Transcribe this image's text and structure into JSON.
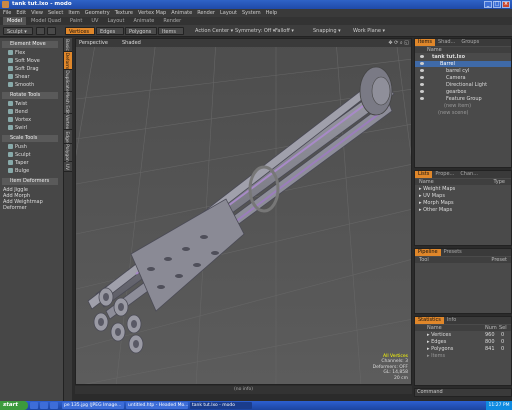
{
  "window": {
    "title": "tank tut.lxo - modo"
  },
  "menu": [
    "File",
    "Edit",
    "View",
    "Select",
    "Item",
    "Geometry",
    "Texture",
    "Vertex Map",
    "Animate",
    "Render",
    "Layout",
    "System",
    "Help"
  ],
  "layout_tabs": [
    {
      "label": "Model",
      "active": true
    },
    {
      "label": "Model Quad",
      "active": false
    },
    {
      "label": "Paint",
      "active": false
    },
    {
      "label": "UV",
      "active": false
    },
    {
      "label": "Layout",
      "active": false
    },
    {
      "label": "Animate",
      "active": false
    },
    {
      "label": "Render",
      "active": false
    }
  ],
  "toolbar": {
    "sculpt": "Sculpt",
    "modes": [
      "Vertices",
      "Edges",
      "Polygons",
      "Items"
    ],
    "action_center": "Action Center",
    "symmetry": "Symmetry: Off",
    "falloff": "Falloff",
    "snapping": "Snapping",
    "work_plane": "Work Plane"
  },
  "toolbox": {
    "element_move": "Element Move",
    "tools1": [
      "Flex",
      "Soft Move",
      "Soft Drag",
      "Shear",
      "Smooth"
    ],
    "rotate_header": "Rotate Tools",
    "tools2": [
      "Twist",
      "Bend",
      "Vortex",
      "Swirl"
    ],
    "scale_header": "Scale Tools",
    "tools3": [
      "Push",
      "Sculpt",
      "Taper",
      "Bulge"
    ],
    "deformers_header": "Item Deformers",
    "adds": [
      "Add Jiggle",
      "Add Morph",
      "Add Weightmap Deformer"
    ],
    "side_tabs": [
      "Basic",
      "Deform",
      "Duplicate",
      "Mesh Edit",
      "Vertex",
      "Edge",
      "Polygon",
      "UV"
    ]
  },
  "viewport": {
    "tab": "Perspective",
    "shading": "Shaded",
    "info": [
      "All Vertices",
      "Channels: 3",
      "Deformers: OFF",
      "GL: 14,858",
      "20 cm"
    ],
    "status": "(no info)"
  },
  "items_panel": {
    "tabs": [
      "Items",
      "Shad...",
      "Groups"
    ],
    "header": "Name",
    "rows": [
      {
        "label": "tank tut.lxo",
        "depth": 0,
        "selected": false
      },
      {
        "label": "Barrel",
        "depth": 1,
        "selected": true
      },
      {
        "label": "barrel cyl",
        "depth": 2,
        "selected": false
      },
      {
        "label": "Camera",
        "depth": 2,
        "selected": false
      },
      {
        "label": "Directional Light",
        "depth": 2,
        "selected": false
      },
      {
        "label": "gearbox",
        "depth": 2,
        "selected": false
      },
      {
        "label": "Feature Group",
        "depth": 2,
        "selected": false
      },
      {
        "label": "(new item)",
        "depth": 2,
        "selected": false
      },
      {
        "label": "(new scene)",
        "depth": 1,
        "selected": false
      }
    ]
  },
  "lists_panel": {
    "tabs": [
      "Lists",
      "Prope...",
      "Chan..."
    ],
    "cols": [
      "Name",
      "Type"
    ],
    "rows": [
      "Weight Maps",
      "UV Maps",
      "Morph Maps",
      "Other Maps"
    ]
  },
  "pipeline_panel": {
    "tabs": [
      "Pipeline",
      "Presets"
    ],
    "cols": [
      "Tool",
      "Preset"
    ]
  },
  "stats_panel": {
    "tabs": [
      "Statistics",
      "Info"
    ],
    "cols": [
      "Name",
      "Num",
      "Sel"
    ],
    "rows": [
      {
        "name": "Vertices",
        "num": "960",
        "sel": "0"
      },
      {
        "name": "Edges",
        "num": "800",
        "sel": "0"
      },
      {
        "name": "Polygons",
        "num": "841",
        "sel": "0"
      },
      {
        "name": "Items",
        "num": "",
        "sel": ""
      }
    ]
  },
  "command": {
    "label": "Command"
  },
  "taskbar": {
    "start": "start",
    "tasks": [
      "pe 135.jpg (JPEG Image...",
      "untitled.htp - Headed Mo...",
      "tank tut.lxo - modo"
    ],
    "clock": "11:27 PM"
  },
  "colors": {
    "accent": "#e0872a",
    "selection": "#3f6aa8",
    "titlebar": "#2f63c7"
  }
}
